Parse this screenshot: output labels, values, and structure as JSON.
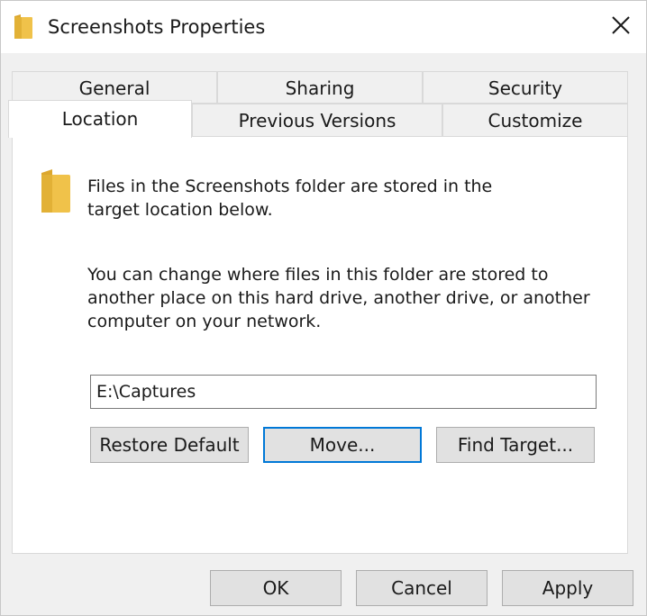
{
  "window": {
    "title": "Screenshots Properties"
  },
  "tabs": {
    "row1": [
      "General",
      "Sharing",
      "Security"
    ],
    "row2": [
      "Location",
      "Previous Versions",
      "Customize"
    ],
    "active": "Location"
  },
  "location": {
    "description": "Files in the Screenshots folder are stored in the target location below.",
    "instructions": "You can change where files in this folder are stored to another place on this hard drive, another drive, or another computer on your network.",
    "path_value": "E:\\Captures",
    "restore_default_label": "Restore Default",
    "move_label": "Move...",
    "find_target_label": "Find Target..."
  },
  "footer": {
    "ok_label": "OK",
    "cancel_label": "Cancel",
    "apply_label": "Apply"
  },
  "icons": {
    "title": "folder-icon",
    "close": "close-icon",
    "location": "folder-icon"
  },
  "colors": {
    "accent": "#0078d7",
    "folder": "#f0c24a",
    "folder_dark": "#dca72e"
  }
}
